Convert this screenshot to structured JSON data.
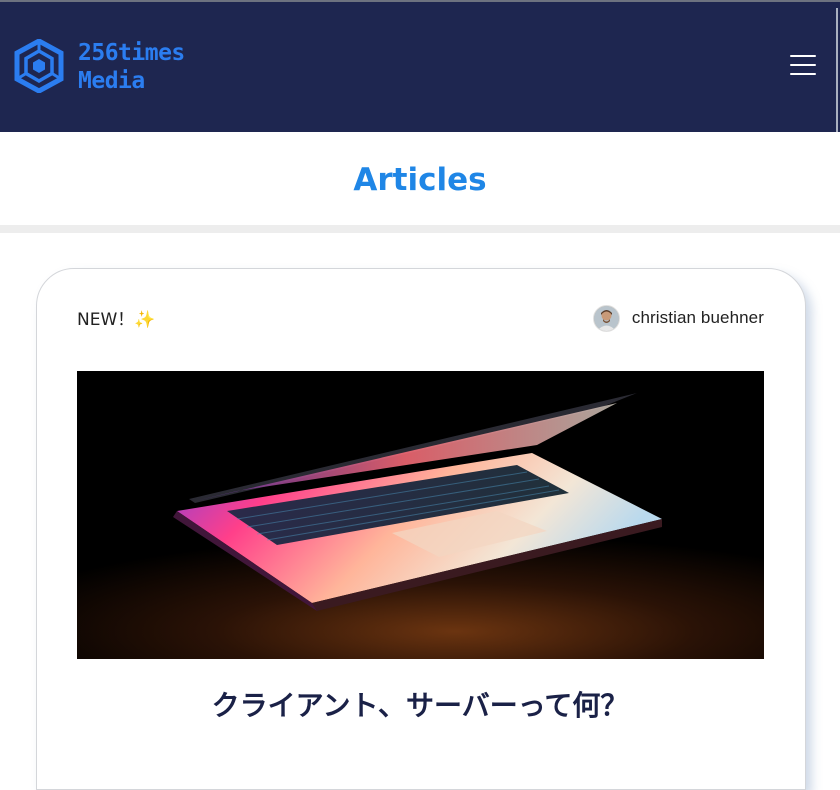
{
  "header": {
    "logo_line1": "256times",
    "logo_line2": "Media",
    "logo_icon": "hexagon-logo-icon",
    "menu_icon": "hamburger-menu-icon",
    "background": "#1e2650",
    "accent": "#2b7df0"
  },
  "page": {
    "title": "Articles",
    "title_color": "#1f86e6"
  },
  "article": {
    "badge": "NEW！",
    "badge_emoji": "✨",
    "author_name": "christian buehner",
    "image_icon": "laptop-photo",
    "title": "クライアント、サーバーって何？"
  }
}
